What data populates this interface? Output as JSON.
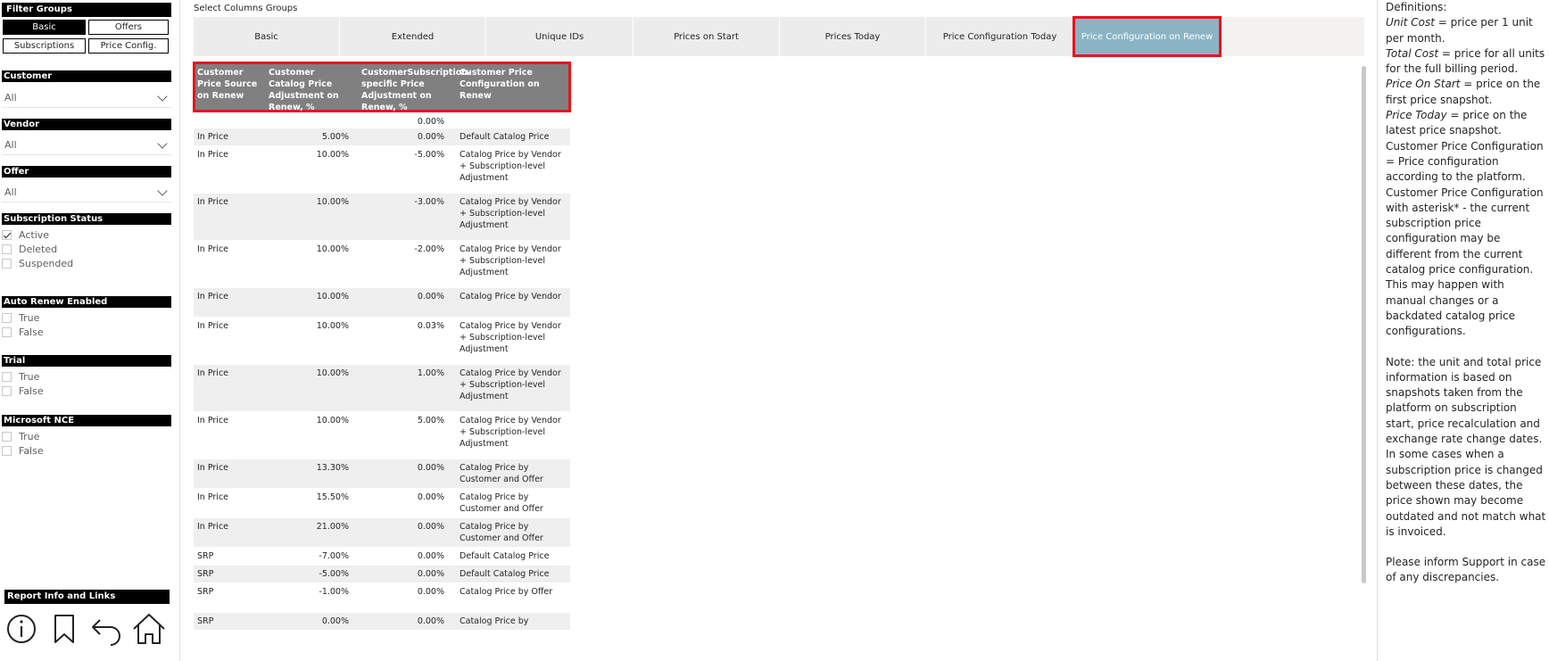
{
  "filters": {
    "groups_title": "Filter Groups",
    "buttons": [
      "Basic",
      "Offers",
      "Subscriptions",
      "Price Config."
    ],
    "customer": {
      "label": "Customer",
      "value": "All"
    },
    "vendor": {
      "label": "Vendor",
      "value": "All"
    },
    "offer": {
      "label": "Offer",
      "value": "All"
    },
    "subscription_status": {
      "label": "Subscription Status",
      "options": [
        "Active",
        "Deleted",
        "Suspended"
      ]
    },
    "auto_renew": {
      "label": "Auto Renew Enabled",
      "options": [
        "True",
        "False"
      ]
    },
    "trial": {
      "label": "Trial",
      "options": [
        "True",
        "False"
      ]
    },
    "ms_nce": {
      "label": "Microsoft NCE",
      "options": [
        "True",
        "False"
      ]
    },
    "report_title": "Report Info and Links"
  },
  "main": {
    "select_label": "Select Columns Groups",
    "tabs": [
      "Basic",
      "Extended",
      "Unique IDs",
      "Prices on Start",
      "Prices Today",
      "Price Configuration Today",
      "Price Configuration on Renew"
    ],
    "columns": [
      "Customer Price Source on Renew",
      "Customer Catalog Price Adjustment on Renew, %",
      "CustomerSubscription-specific Price Adjustment on Renew, %",
      "Customer Price Configuration on Renew"
    ],
    "rows": [
      {
        "source": "",
        "catalog": "",
        "specific": "0.00%",
        "config": ""
      },
      {
        "source": "In Price",
        "catalog": "5.00%",
        "specific": "0.00%",
        "config": "Default Catalog Price"
      },
      {
        "source": "In Price",
        "catalog": "10.00%",
        "specific": "-5.00%",
        "config": "Catalog Price by Vendor + Subscription-level Adjustment"
      },
      {
        "source": "In Price",
        "catalog": "10.00%",
        "specific": "-3.00%",
        "config": "Catalog Price by Vendor + Subscription-level Adjustment"
      },
      {
        "source": "In Price",
        "catalog": "10.00%",
        "specific": "-2.00%",
        "config": "Catalog Price by Vendor + Subscription-level Adjustment"
      },
      {
        "source": "In Price",
        "catalog": "10.00%",
        "specific": "0.00%",
        "config": "Catalog Price by Vendor"
      },
      {
        "source": "In Price",
        "catalog": "10.00%",
        "specific": "0.03%",
        "config": "Catalog Price by Vendor + Subscription-level Adjustment"
      },
      {
        "source": "In Price",
        "catalog": "10.00%",
        "specific": "1.00%",
        "config": "Catalog Price by Vendor + Subscription-level Adjustment"
      },
      {
        "source": "In Price",
        "catalog": "10.00%",
        "specific": "5.00%",
        "config": "Catalog Price by Vendor + Subscription-level Adjustment"
      },
      {
        "source": "In Price",
        "catalog": "13.30%",
        "specific": "0.00%",
        "config": "Catalog Price by Customer and Offer"
      },
      {
        "source": "In Price",
        "catalog": "15.50%",
        "specific": "0.00%",
        "config": "Catalog Price by Customer and Offer"
      },
      {
        "source": "In Price",
        "catalog": "21.00%",
        "specific": "0.00%",
        "config": "Catalog Price by Customer and Offer"
      },
      {
        "source": "SRP",
        "catalog": "-7.00%",
        "specific": "0.00%",
        "config": "Default Catalog Price"
      },
      {
        "source": "SRP",
        "catalog": "-5.00%",
        "specific": "0.00%",
        "config": "Default Catalog Price"
      },
      {
        "source": "SRP",
        "catalog": "-1.00%",
        "specific": "0.00%",
        "config": "Catalog Price by Offer"
      },
      {
        "source": "SRP",
        "catalog": "0.00%",
        "specific": "0.00%",
        "config": "Catalog Price by"
      }
    ]
  },
  "definitions": {
    "title": "Definitions:",
    "unit_cost_term": "Unit Cost",
    "unit_cost_text": " = price per 1 unit per month.",
    "total_cost_term": "Total Cost",
    "total_cost_text": " = price for all units for the full billing period.",
    "price_start_term": "Price On Start",
    "price_start_text": " = price on the first price snapshot.",
    "price_today_term": "Price Today",
    "price_today_text": " = price on the latest price snapshot.",
    "cpc_text": "Customer Price Configuration = Price configuration according to the platform.",
    "cpc_asterisk_text": "Customer Price Configuration with asterisk* - the current subscription price configuration may be different from the current catalog price configuration.",
    "happen_a": "This may happen with ",
    "happen_b": "manual changes",
    "happen_c": " or a ",
    "happen_d": "backdated",
    "happen_e": " catalog price configurations.",
    "note_a": "Note:",
    "note_b": " the ",
    "note_c": "unit",
    "note_d": " and ",
    "note_e": "total price",
    "note_f": " information is based on snapshots taken from the platform on ",
    "note_g": "subscription start",
    "note_h": ", ",
    "note_i": "price recalculation",
    "note_j": " and ",
    "note_k": "exchange rate change dates",
    "note_l": ". In some cases when a subscription price is changed between these dates, the price shown may become outdated and not match what is invoiced.",
    "support_text": "Please inform Support in case of any discrepancies."
  }
}
